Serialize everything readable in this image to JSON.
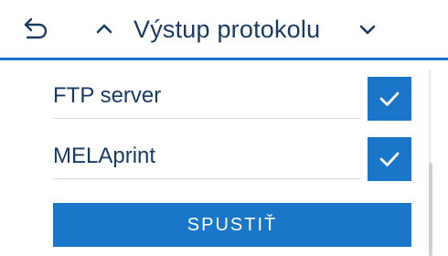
{
  "header": {
    "title": "Výstup protokolu",
    "back_icon": "undo-arrow-icon",
    "up_icon": "chevron-up-icon",
    "down_icon": "chevron-down-icon"
  },
  "settings": {
    "items": [
      {
        "label": "FTP server",
        "checked": true
      },
      {
        "label": "MELAprint",
        "checked": true
      }
    ]
  },
  "actions": {
    "start_label": "SPUSTIŤ"
  },
  "colors": {
    "accent": "#1976c8",
    "text": "#1a3a66",
    "divider": "#d7dde5"
  }
}
